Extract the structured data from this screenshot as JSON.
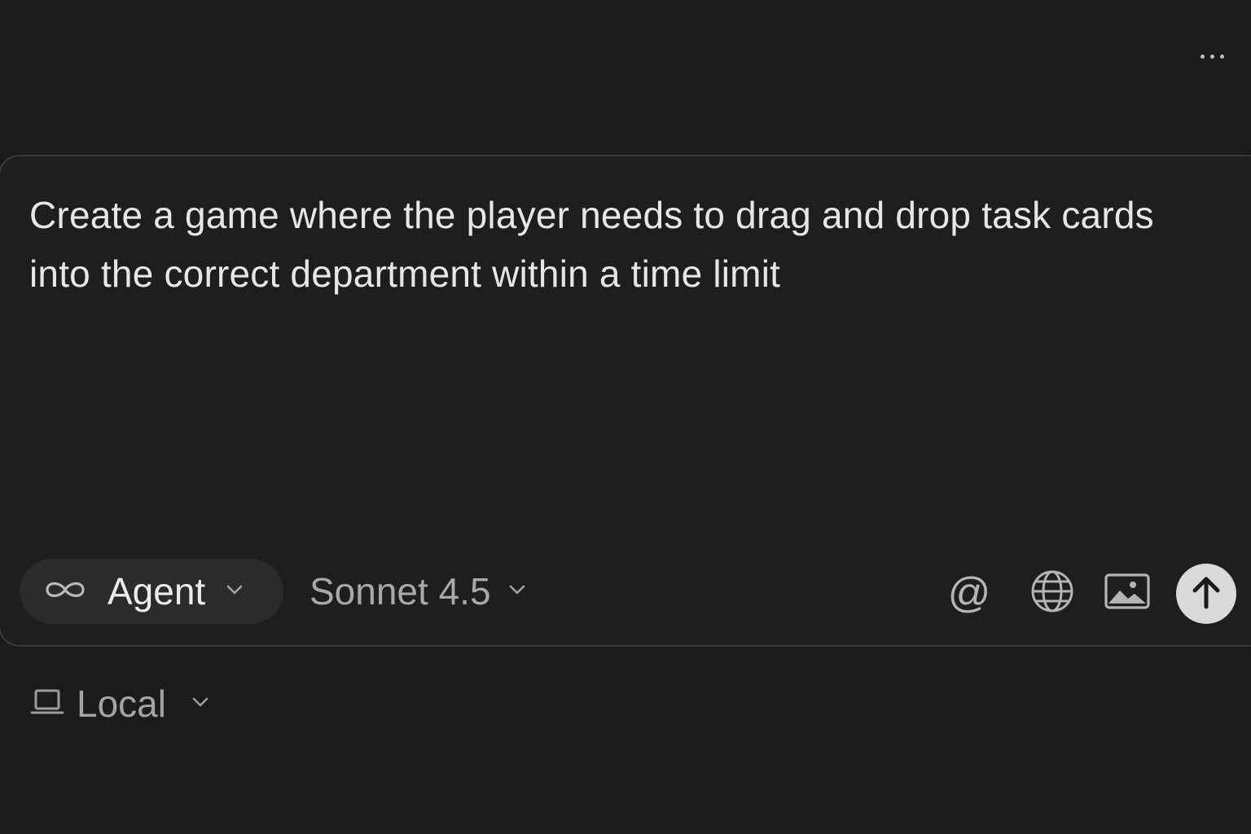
{
  "header": {
    "more_icon": "ellipsis-icon"
  },
  "composer": {
    "prompt_text": "Create a game where the player needs to drag and drop task cards into the correct department within a time limit",
    "mode": {
      "icon": "infinity-icon",
      "label": "Agent"
    },
    "model": {
      "label": "Sonnet 4.5"
    },
    "tools": {
      "mention": "@",
      "web_icon": "globe-icon",
      "image_icon": "image-icon",
      "send_icon": "arrow-up-icon"
    }
  },
  "environment": {
    "icon": "laptop-icon",
    "label": "Local"
  },
  "colors": {
    "background": "#1b1b1b",
    "composer_border": "#3a3a3a",
    "pill_background": "#2b2b2b",
    "send_button": "#d9d9d9"
  }
}
